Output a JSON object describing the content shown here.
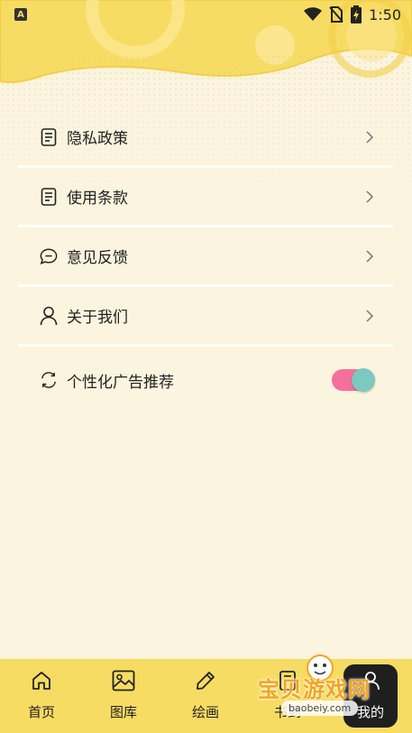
{
  "status_bar": {
    "app_badge": "A",
    "time": "1:50"
  },
  "menu": {
    "items": [
      {
        "label": "隐私政策",
        "icon": "document-icon"
      },
      {
        "label": "使用条款",
        "icon": "document-icon"
      },
      {
        "label": "意见反馈",
        "icon": "chat-bubble-icon"
      },
      {
        "label": "关于我们",
        "icon": "person-icon"
      }
    ],
    "toggle": {
      "label": "个性化广告推荐",
      "icon": "refresh-icon",
      "on": true
    }
  },
  "nav": {
    "items": [
      {
        "label": "首页",
        "icon": "home-icon"
      },
      {
        "label": "图库",
        "icon": "image-icon"
      },
      {
        "label": "绘画",
        "icon": "pencil-icon"
      },
      {
        "label": "书到",
        "icon": "book-icon"
      },
      {
        "label": "我的",
        "icon": "profile-icon",
        "active": true
      }
    ]
  },
  "watermark": {
    "text": "宝贝游戏网",
    "url": "baobeiy.com"
  },
  "colors": {
    "background": "#fbf4de",
    "header": "#f7dc63",
    "toggle_track": "#f56f9c",
    "toggle_knob": "#7cc9c1",
    "nav_active": "#1f1f1f"
  }
}
